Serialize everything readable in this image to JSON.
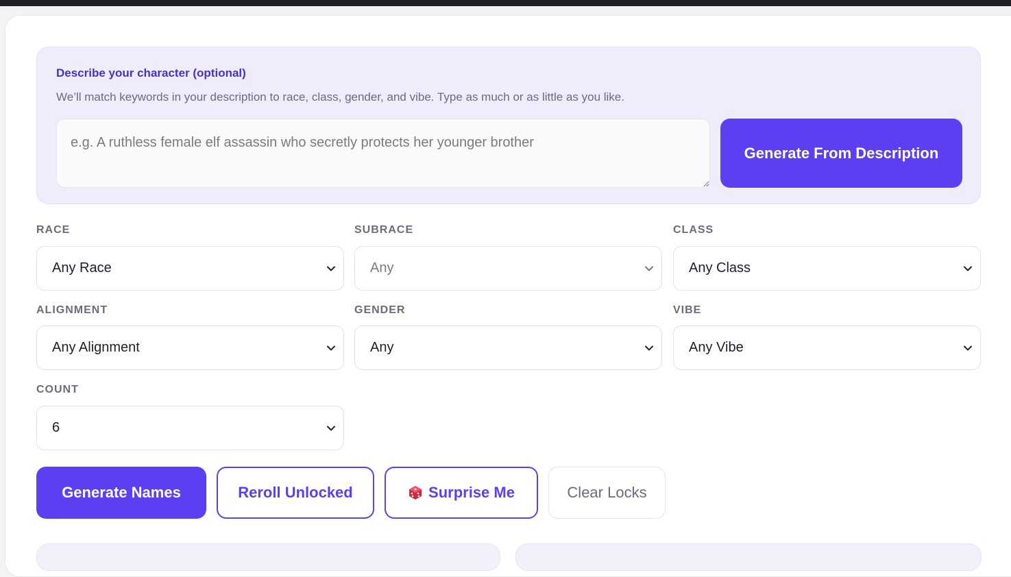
{
  "description": {
    "title": "Describe your character (optional)",
    "hint": "We’ll match keywords in your description to race, class, gender, and vibe. Type as much or as little as you like.",
    "textarea_value": "",
    "textarea_placeholder": "e.g. A ruthless female elf assassin who secretly protects her younger brother",
    "generate_button": "Generate From Description"
  },
  "filters": {
    "race": {
      "label": "RACE",
      "value": "Any Race"
    },
    "subrace": {
      "label": "SUBRACE",
      "value": "Any"
    },
    "class": {
      "label": "CLASS",
      "value": "Any Class"
    },
    "alignment": {
      "label": "ALIGNMENT",
      "value": "Any Alignment"
    },
    "gender": {
      "label": "GENDER",
      "value": "Any"
    },
    "vibe": {
      "label": "VIBE",
      "value": "Any Vibe"
    },
    "count": {
      "label": "COUNT",
      "value": "6"
    }
  },
  "actions": {
    "generate": "Generate Names",
    "reroll": "Reroll Unlocked",
    "surprise": "Surprise Me",
    "clear": "Clear Locks"
  },
  "icons": {
    "select_chevron": "chevron-down-icon",
    "surprise": "dice-icon"
  },
  "colors": {
    "accent": "#5b3ff0",
    "panel_bg": "#efedfc",
    "title_purple": "#4a2fc9",
    "muted_text": "#6b6b7b"
  }
}
